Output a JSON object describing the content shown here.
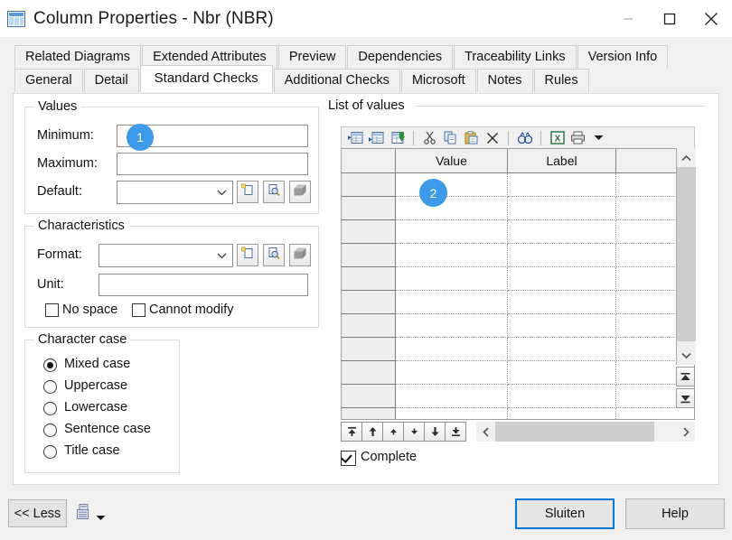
{
  "window": {
    "title": "Column Properties - Nbr (NBR)",
    "icon": "table-grid-icon",
    "minimize_label": "–",
    "maximize_label": "□",
    "close_label": "✕"
  },
  "tabs": {
    "row1": [
      {
        "label": "Related Diagrams",
        "active": false
      },
      {
        "label": "Extended Attributes",
        "active": false
      },
      {
        "label": "Preview",
        "active": false
      },
      {
        "label": "Dependencies",
        "active": false
      },
      {
        "label": "Traceability Links",
        "active": false
      },
      {
        "label": "Version Info",
        "active": false
      }
    ],
    "row2": [
      {
        "label": "General",
        "active": false
      },
      {
        "label": "Detail",
        "active": false
      },
      {
        "label": "Standard Checks",
        "active": true
      },
      {
        "label": "Additional Checks",
        "active": false
      },
      {
        "label": "Microsoft",
        "active": false
      },
      {
        "label": "Notes",
        "active": false
      },
      {
        "label": "Rules",
        "active": false
      }
    ]
  },
  "values_group": {
    "legend": "Values",
    "minimum_label": "Minimum:",
    "minimum_value": "",
    "maximum_label": "Maximum:",
    "maximum_value": "",
    "default_label": "Default:",
    "default_value": ""
  },
  "characteristics_group": {
    "legend": "Characteristics",
    "format_label": "Format:",
    "format_value": "",
    "unit_label": "Unit:",
    "unit_value": "",
    "no_space_label": "No space",
    "no_space_checked": false,
    "cannot_modify_label": "Cannot modify",
    "cannot_modify_checked": false
  },
  "character_case_group": {
    "legend": "Character case",
    "options": [
      {
        "label": "Mixed case",
        "selected": true
      },
      {
        "label": "Uppercase",
        "selected": false
      },
      {
        "label": "Lowercase",
        "selected": false
      },
      {
        "label": "Sentence case",
        "selected": false
      },
      {
        "label": "Title case",
        "selected": false
      }
    ]
  },
  "list_of_values": {
    "legend": "List of values",
    "toolbar": [
      {
        "name": "insert-row-icon",
        "tooltip": "Insert a Row"
      },
      {
        "name": "add-row-icon",
        "tooltip": "Add a Row"
      },
      {
        "name": "delete-row-icon",
        "tooltip": "Delete a Row"
      },
      {
        "name": "cut-icon",
        "tooltip": "Cut"
      },
      {
        "name": "copy-icon",
        "tooltip": "Copy"
      },
      {
        "name": "paste-icon",
        "tooltip": "Paste"
      },
      {
        "name": "delete-icon",
        "tooltip": "Delete"
      },
      {
        "name": "find-icon",
        "tooltip": "Find"
      },
      {
        "name": "excel-export-icon",
        "tooltip": "Export to Excel"
      },
      {
        "name": "print-icon",
        "tooltip": "Print"
      },
      {
        "name": "dropdown-arrow-icon",
        "tooltip": "More"
      }
    ],
    "columns": [
      "",
      "Value",
      "Label",
      ""
    ],
    "rows": [
      {
        "value": "",
        "label": ""
      },
      {
        "value": "",
        "label": ""
      },
      {
        "value": "",
        "label": ""
      },
      {
        "value": "",
        "label": ""
      },
      {
        "value": "",
        "label": ""
      },
      {
        "value": "",
        "label": ""
      },
      {
        "value": "",
        "label": ""
      },
      {
        "value": "",
        "label": ""
      },
      {
        "value": "",
        "label": ""
      },
      {
        "value": "",
        "label": ""
      },
      {
        "value": "",
        "label": ""
      }
    ],
    "move_buttons": [
      {
        "name": "move-to-top-button"
      },
      {
        "name": "move-up-block-button"
      },
      {
        "name": "move-up-button"
      },
      {
        "name": "move-down-button"
      },
      {
        "name": "move-down-block-button"
      },
      {
        "name": "move-to-bottom-button"
      }
    ],
    "complete_label": "Complete",
    "complete_checked": true
  },
  "footer": {
    "less_label": "<< Less",
    "report_icon": "report-icon",
    "report_dropdown_icon": "dropdown-arrow-icon",
    "close_label": "Sluiten",
    "help_label": "Help"
  },
  "annotations": [
    {
      "id": "1",
      "target": "minimum-input"
    },
    {
      "id": "2",
      "target": "grid-cell-value-row-0"
    }
  ],
  "colors": {
    "badge": "#3d9ae8",
    "focus_border": "#0078d7",
    "window_bg": "#f0f0f0",
    "content_bg": "#ffffff"
  }
}
